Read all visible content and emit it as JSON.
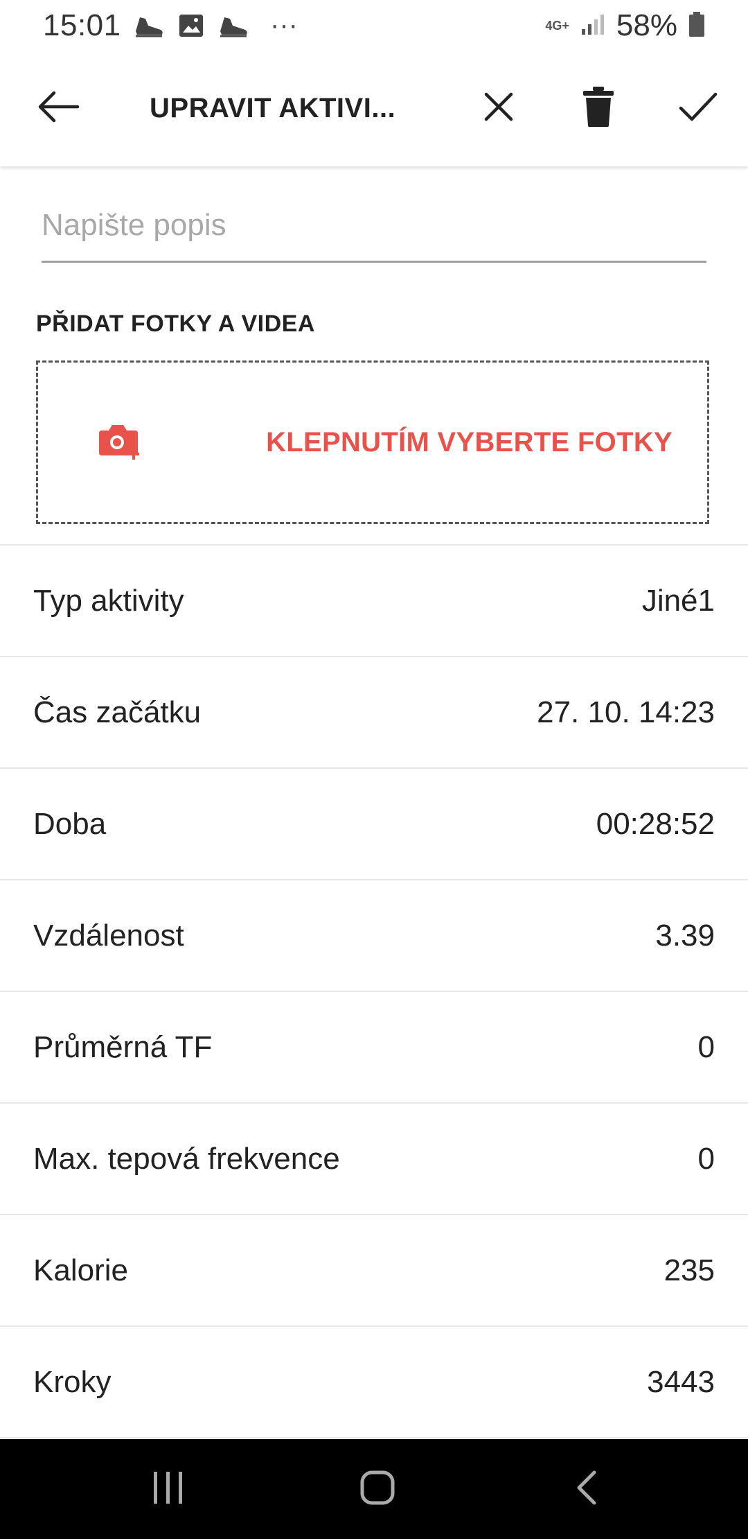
{
  "status_bar": {
    "time": "15:01",
    "battery_text": "58%",
    "network": "4G+",
    "more": "···",
    "icons": [
      "shoe-icon",
      "image-icon",
      "shoe-icon",
      "more-icon",
      "network-icon",
      "signal-icon",
      "battery-icon"
    ]
  },
  "app_bar": {
    "title": "UPRAVIT AKTIVI...",
    "icons": [
      "back-arrow-icon",
      "close-icon",
      "trash-icon",
      "check-icon"
    ]
  },
  "description": {
    "placeholder": "Napište popis",
    "value": ""
  },
  "media": {
    "section_label": "PŘIDAT FOTKY A VIDEA",
    "button_label": "KLEPNUTÍM VYBERTE FOTKY",
    "icon": "add-photo-icon"
  },
  "rows": [
    {
      "label": "Typ aktivity",
      "value": "Jiné1"
    },
    {
      "label": "Čas začátku",
      "value": "27. 10. 14:23"
    },
    {
      "label": "Doba",
      "value": "00:28:52"
    },
    {
      "label": "Vzdálenost",
      "value": "3.39"
    },
    {
      "label": "Průměrná TF",
      "value": "0"
    },
    {
      "label": "Max. tepová frekvence",
      "value": "0"
    },
    {
      "label": "Kalorie",
      "value": "235"
    },
    {
      "label": "Kroky",
      "value": "3443"
    }
  ],
  "nav_bar": {
    "icons": [
      "recents-icon",
      "home-icon",
      "back-icon"
    ]
  },
  "colors": {
    "accent": "#e8524a",
    "text": "#222222",
    "placeholder": "#a8a8a8",
    "divider": "#e6e6e6",
    "nav_background": "#000000"
  }
}
